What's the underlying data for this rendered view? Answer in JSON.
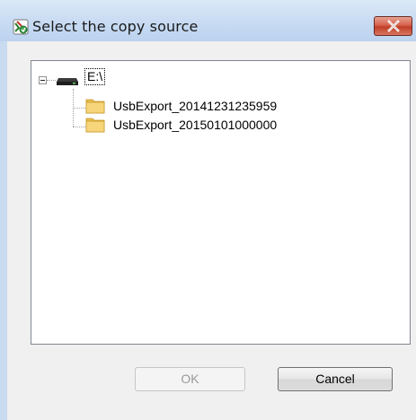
{
  "window": {
    "title": "Select the copy source",
    "icon": "app-icon",
    "close_icon": "close-x-icon"
  },
  "tree": {
    "root": {
      "label": "E:\\",
      "icon": "drive-icon",
      "expanded": true,
      "selected": true,
      "children": [
        {
          "label": "UsbExport_20141231235959",
          "icon": "folder-icon"
        },
        {
          "label": "UsbExport_20150101000000",
          "icon": "folder-icon"
        }
      ]
    }
  },
  "buttons": {
    "ok_label": "OK",
    "ok_enabled": false,
    "cancel_label": "Cancel"
  },
  "colors": {
    "titlebar": "#c6daf2",
    "close_button": "#c9452d",
    "folder": "#f2cc6a",
    "disabled_text": "#9a9a9a"
  }
}
